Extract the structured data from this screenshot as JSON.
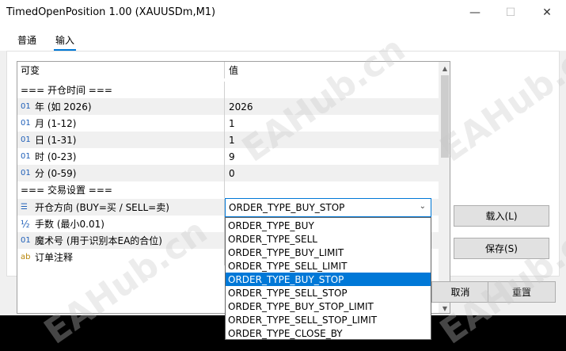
{
  "window": {
    "title": "TimedOpenPosition 1.00 (XAUUSDm,M1)",
    "min_glyph": "—",
    "max_glyph": "☐",
    "close_glyph": "✕"
  },
  "tabs": [
    {
      "label": "普通"
    },
    {
      "label": "输入"
    }
  ],
  "grid": {
    "columns": [
      "可变",
      "值"
    ],
    "rows": [
      {
        "icon": "",
        "name": "=== 开仓时间 ===",
        "value": ""
      },
      {
        "icon": "01",
        "name": "年 (如 2026)",
        "value": "2026"
      },
      {
        "icon": "01",
        "name": "月 (1-12)",
        "value": "1"
      },
      {
        "icon": "01",
        "name": "日 (1-31)",
        "value": "1"
      },
      {
        "icon": "01",
        "name": "时 (0-23)",
        "value": "9"
      },
      {
        "icon": "01",
        "name": "分 (0-59)",
        "value": "0"
      },
      {
        "icon": "",
        "name": "=== 交易设置 ===",
        "value": ""
      },
      {
        "icon": "☰",
        "name": "开仓方向 (BUY=买 / SELL=卖)",
        "value": ""
      },
      {
        "icon": "½",
        "name": "手数 (最小0.01)",
        "value": ""
      },
      {
        "icon": "01",
        "name": "魔术号 (用于识别本EA的合位)",
        "value": ""
      },
      {
        "icon": "ab",
        "name": "订单注释",
        "value": ""
      }
    ]
  },
  "combo": {
    "selected": "ORDER_TYPE_BUY_STOP",
    "arrow": "⌄",
    "options": [
      "ORDER_TYPE_BUY",
      "ORDER_TYPE_SELL",
      "ORDER_TYPE_BUY_LIMIT",
      "ORDER_TYPE_SELL_LIMIT",
      "ORDER_TYPE_BUY_STOP",
      "ORDER_TYPE_SELL_STOP",
      "ORDER_TYPE_BUY_STOP_LIMIT",
      "ORDER_TYPE_SELL_STOP_LIMIT",
      "ORDER_TYPE_CLOSE_BY"
    ]
  },
  "scrollbar": {
    "up": "▲",
    "down": "▼"
  },
  "buttons": {
    "load": "载入(L)",
    "save": "保存(S)",
    "cancel": "取消",
    "reset": "重置"
  },
  "watermark": "EAHub.cn",
  "colors": {
    "accent": "#0078d7",
    "selection": "#0078d7"
  }
}
